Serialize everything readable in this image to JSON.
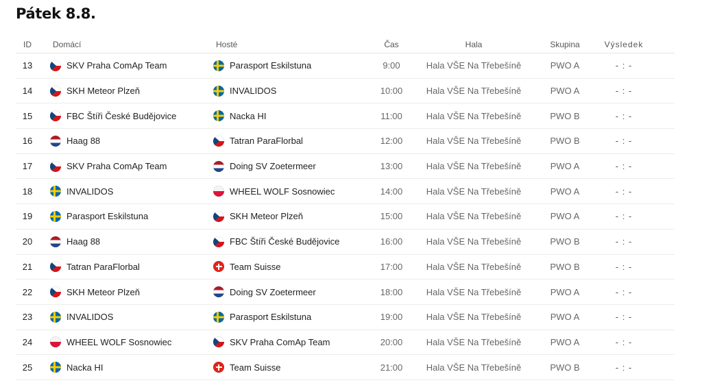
{
  "day_title": "Pátek 8.8.",
  "columns": {
    "id": "ID",
    "home": "Domácí",
    "guest": "Hosté",
    "time": "Čas",
    "hall": "Hala",
    "group": "Skupina",
    "result": "Výsledek"
  },
  "flag_colors": {
    "cz": [
      "#11457e",
      "#ffffff",
      "#d7141a"
    ],
    "se": [
      "#006aa7",
      "#fecc02"
    ],
    "nl": [
      "#ae1c28",
      "#ffffff",
      "#21468b"
    ],
    "pl": [
      "#ffffff",
      "#dc143c"
    ],
    "ch": [
      "#e2231a",
      "#ffffff"
    ]
  },
  "matches": [
    {
      "id": "13",
      "home": {
        "name": "SKV Praha ComAp Team",
        "flag": "cz"
      },
      "guest": {
        "name": "Parasport Eskilstuna",
        "flag": "se"
      },
      "time": "9:00",
      "hall": "Hala VŠE Na Třebešíně",
      "group": "PWO A",
      "result": "- : -"
    },
    {
      "id": "14",
      "home": {
        "name": "SKH Meteor Plzeň",
        "flag": "cz"
      },
      "guest": {
        "name": "INVALIDOS",
        "flag": "se"
      },
      "time": "10:00",
      "hall": "Hala VŠE Na Třebešíně",
      "group": "PWO A",
      "result": "- : -"
    },
    {
      "id": "15",
      "home": {
        "name": "FBC Štíři České Budějovice",
        "flag": "cz"
      },
      "guest": {
        "name": "Nacka HI",
        "flag": "se"
      },
      "time": "11:00",
      "hall": "Hala VŠE Na Třebešíně",
      "group": "PWO B",
      "result": "- : -"
    },
    {
      "id": "16",
      "home": {
        "name": "Haag 88",
        "flag": "nl"
      },
      "guest": {
        "name": "Tatran ParaFlorbal",
        "flag": "cz"
      },
      "time": "12:00",
      "hall": "Hala VŠE Na Třebešíně",
      "group": "PWO B",
      "result": "- : -"
    },
    {
      "id": "17",
      "home": {
        "name": "SKV Praha ComAp Team",
        "flag": "cz"
      },
      "guest": {
        "name": "Doing SV Zoetermeer",
        "flag": "nl"
      },
      "time": "13:00",
      "hall": "Hala VŠE Na Třebešíně",
      "group": "PWO A",
      "result": "- : -"
    },
    {
      "id": "18",
      "home": {
        "name": "INVALIDOS",
        "flag": "se"
      },
      "guest": {
        "name": "WHEEL WOLF Sosnowiec",
        "flag": "pl"
      },
      "time": "14:00",
      "hall": "Hala VŠE Na Třebešíně",
      "group": "PWO A",
      "result": "- : -"
    },
    {
      "id": "19",
      "home": {
        "name": "Parasport Eskilstuna",
        "flag": "se"
      },
      "guest": {
        "name": "SKH Meteor Plzeň",
        "flag": "cz"
      },
      "time": "15:00",
      "hall": "Hala VŠE Na Třebešíně",
      "group": "PWO A",
      "result": "- : -"
    },
    {
      "id": "20",
      "home": {
        "name": "Haag 88",
        "flag": "nl"
      },
      "guest": {
        "name": "FBC Štíři České Budějovice",
        "flag": "cz"
      },
      "time": "16:00",
      "hall": "Hala VŠE Na Třebešíně",
      "group": "PWO B",
      "result": "- : -"
    },
    {
      "id": "21",
      "home": {
        "name": "Tatran ParaFlorbal",
        "flag": "cz"
      },
      "guest": {
        "name": "Team Suisse",
        "flag": "ch"
      },
      "time": "17:00",
      "hall": "Hala VŠE Na Třebešíně",
      "group": "PWO B",
      "result": "- : -"
    },
    {
      "id": "22",
      "home": {
        "name": "SKH Meteor Plzeň",
        "flag": "cz"
      },
      "guest": {
        "name": "Doing SV Zoetermeer",
        "flag": "nl"
      },
      "time": "18:00",
      "hall": "Hala VŠE Na Třebešíně",
      "group": "PWO A",
      "result": "- : -"
    },
    {
      "id": "23",
      "home": {
        "name": "INVALIDOS",
        "flag": "se"
      },
      "guest": {
        "name": "Parasport Eskilstuna",
        "flag": "se"
      },
      "time": "19:00",
      "hall": "Hala VŠE Na Třebešíně",
      "group": "PWO A",
      "result": "- : -"
    },
    {
      "id": "24",
      "home": {
        "name": "WHEEL WOLF Sosnowiec",
        "flag": "pl"
      },
      "guest": {
        "name": "SKV Praha ComAp Team",
        "flag": "cz"
      },
      "time": "20:00",
      "hall": "Hala VŠE Na Třebešíně",
      "group": "PWO A",
      "result": "- : -"
    },
    {
      "id": "25",
      "home": {
        "name": "Nacka HI",
        "flag": "se"
      },
      "guest": {
        "name": "Team Suisse",
        "flag": "ch"
      },
      "time": "21:00",
      "hall": "Hala VŠE Na Třebešíně",
      "group": "PWO B",
      "result": "- : -"
    }
  ]
}
